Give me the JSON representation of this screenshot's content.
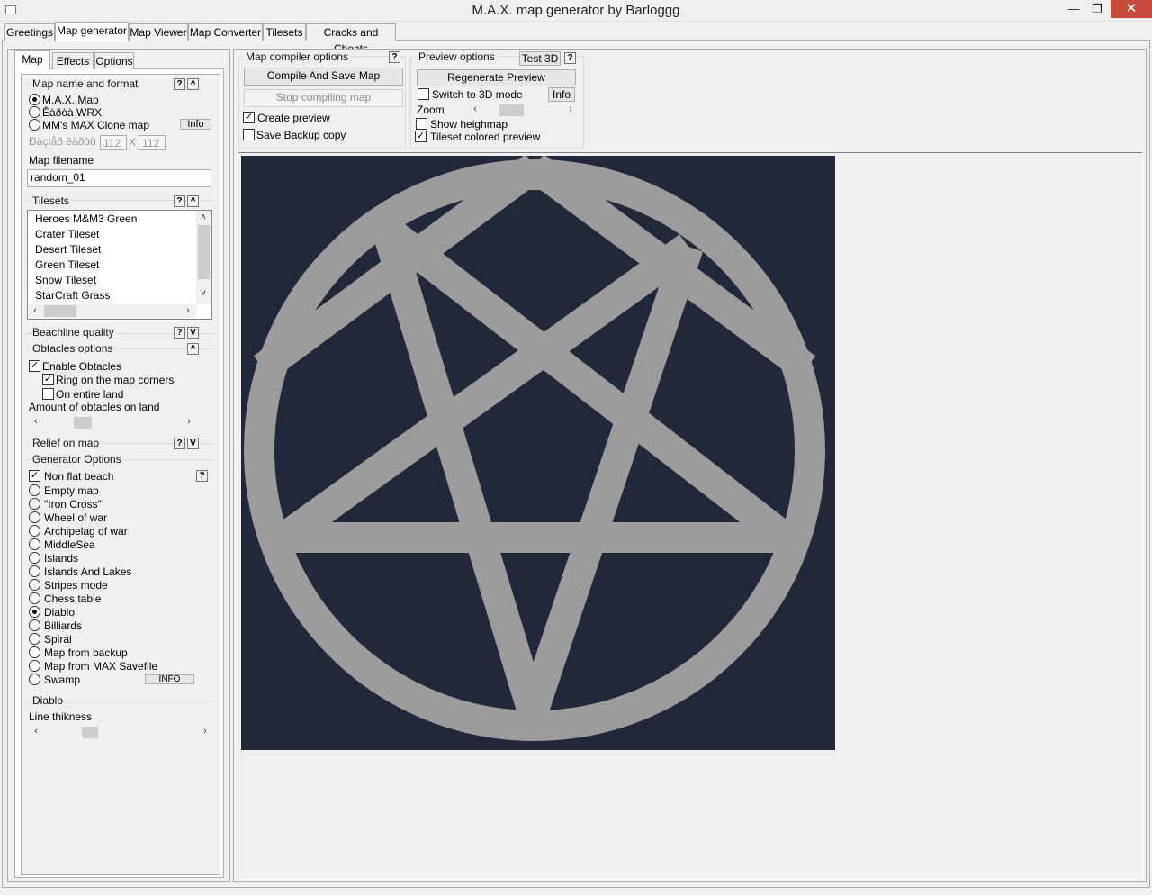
{
  "window": {
    "title": "M.A.X. map generator by Barloggg",
    "minimize": "—",
    "maximize": "❐",
    "close": "✕"
  },
  "main_tabs": [
    "Greetings",
    "Map generator",
    "Map Viewer",
    "Map Converter",
    "Tilesets",
    "Cracks and Cheats"
  ],
  "sub_tabs": [
    "Map",
    "Effects",
    "Options"
  ],
  "map_name_format": {
    "title": "Map name and format",
    "help": "?",
    "collapse": "^",
    "formats": [
      "M.A.X. Map",
      "Êàðòà WRX",
      "MM's MAX Clone map"
    ],
    "info_btn": "Info",
    "size_label": "Ðàçìåð êàðòû",
    "width": "112",
    "x_sep": "X",
    "height": "112",
    "filename_label": "Map filename",
    "filename": "random_01"
  },
  "tilesets": {
    "title": "Tilesets",
    "help": "?",
    "collapse": "^",
    "items": [
      "Heroes M&M3 Green",
      "Crater Tileset",
      "Desert Tileset",
      "Green Tileset",
      "Snow Tileset",
      "StarCraft Grass"
    ]
  },
  "beachline": {
    "title": "Beachline quality",
    "help": "?",
    "expand": "V"
  },
  "obstacles": {
    "title": "Obtacles options",
    "collapse": "^",
    "enable": "Enable Obtacles",
    "ring": "Ring on the map corners",
    "entire": "On entire land",
    "amount_label": "Amount of obtacles on land"
  },
  "relief": {
    "title": "Relief on map",
    "help": "?",
    "expand": "V"
  },
  "generator": {
    "title": "Generator Options",
    "non_flat": "Non flat beach",
    "help": "?",
    "modes": [
      "Empty map",
      "\"Iron Cross\"",
      "Wheel of war",
      "Archipelag of war",
      "MiddleSea",
      "Islands",
      "Islands And Lakes",
      "Stripes mode",
      "Chess table",
      "Diablo",
      "Billiards",
      "Spiral",
      "Map from backup",
      "Map from MAX Savefile",
      "Swamp"
    ],
    "selected": "Diablo",
    "info_btn": "INFO"
  },
  "diablo": {
    "title": "Diablo",
    "line_label": "Line thikness"
  },
  "compiler": {
    "title": "Map compiler options",
    "help": "?",
    "compile_btn": "Compile And Save Map",
    "stop_btn": "Stop compiling map",
    "create_preview": "Create preview",
    "save_backup": "Save Backup copy"
  },
  "preview_opts": {
    "title": "Preview options",
    "test3d": "Test 3D",
    "help": "?",
    "regen": "Regenerate Preview",
    "switch3d": "Switch to 3D mode",
    "info": "Info",
    "zoom": "Zoom",
    "heightmap": "Show heighmap",
    "colored": "Tileset colored preview"
  },
  "preview": {
    "sea_color": "#22273a",
    "land_color": "#9c9c9c"
  },
  "icons": {
    "left": "‹",
    "right": "›",
    "up": "˄",
    "down": "˅",
    "check": "✓"
  }
}
